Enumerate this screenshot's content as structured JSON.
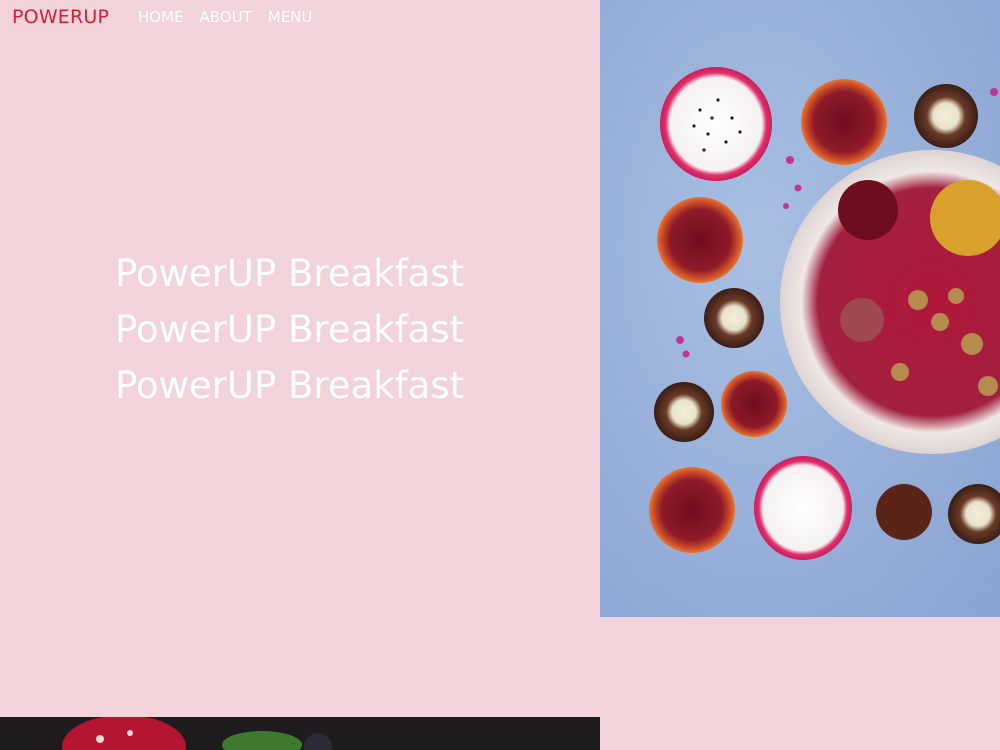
{
  "nav": {
    "brand": "POWERUP",
    "links": [
      "HOME",
      "ABOUT",
      "MENU"
    ]
  },
  "hero": {
    "lines": [
      "PowerUP Breakfast",
      "PowerUP Breakfast",
      "PowerUP Breakfast"
    ]
  },
  "colors": {
    "background": "#f3d3da",
    "brand": "#d11f3a",
    "nav_text": "#ffffff",
    "hero_text": "#ffffff",
    "photo_backdrop": "#9bb4dc",
    "bottom_photo_backdrop": "#1e1c1d"
  }
}
